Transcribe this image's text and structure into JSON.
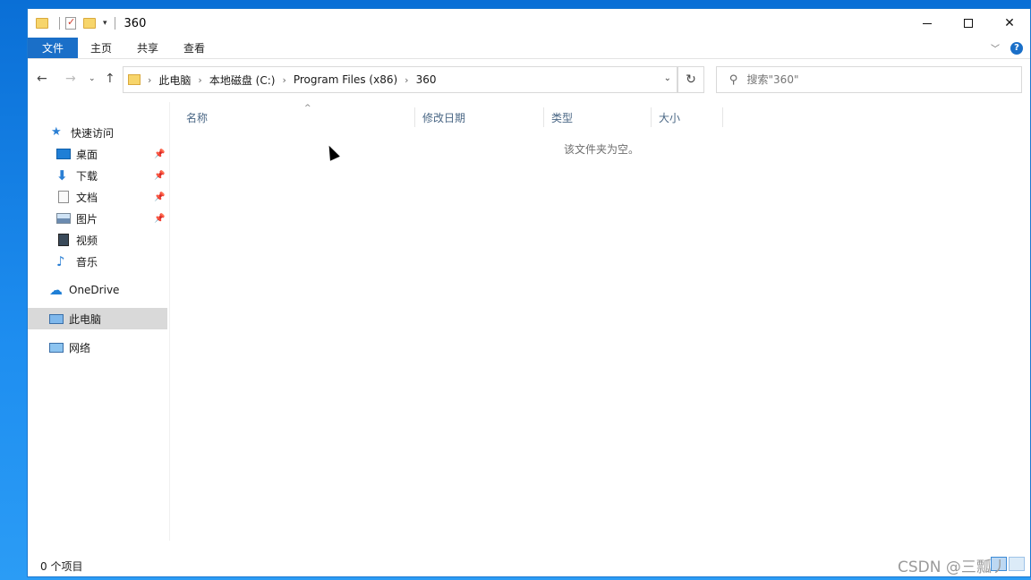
{
  "titlebar": {
    "title": "360"
  },
  "ribbon": {
    "tabs": [
      "文件",
      "主页",
      "共享",
      "查看"
    ]
  },
  "address": {
    "crumbs": [
      "此电脑",
      "本地磁盘 (C:)",
      "Program Files (x86)",
      "360"
    ]
  },
  "search": {
    "placeholder": "搜索\"360\""
  },
  "navpane": {
    "quick_access": "快速访问",
    "items": [
      "桌面",
      "下载",
      "文档",
      "图片",
      "视频",
      "音乐"
    ],
    "onedrive": "OneDrive",
    "this_pc": "此电脑",
    "network": "网络"
  },
  "columns": [
    "名称",
    "修改日期",
    "类型",
    "大小"
  ],
  "content": {
    "empty_message": "该文件夹为空。"
  },
  "status": {
    "item_count": "0 个项目"
  },
  "watermark": "CSDN @三瓢丿"
}
